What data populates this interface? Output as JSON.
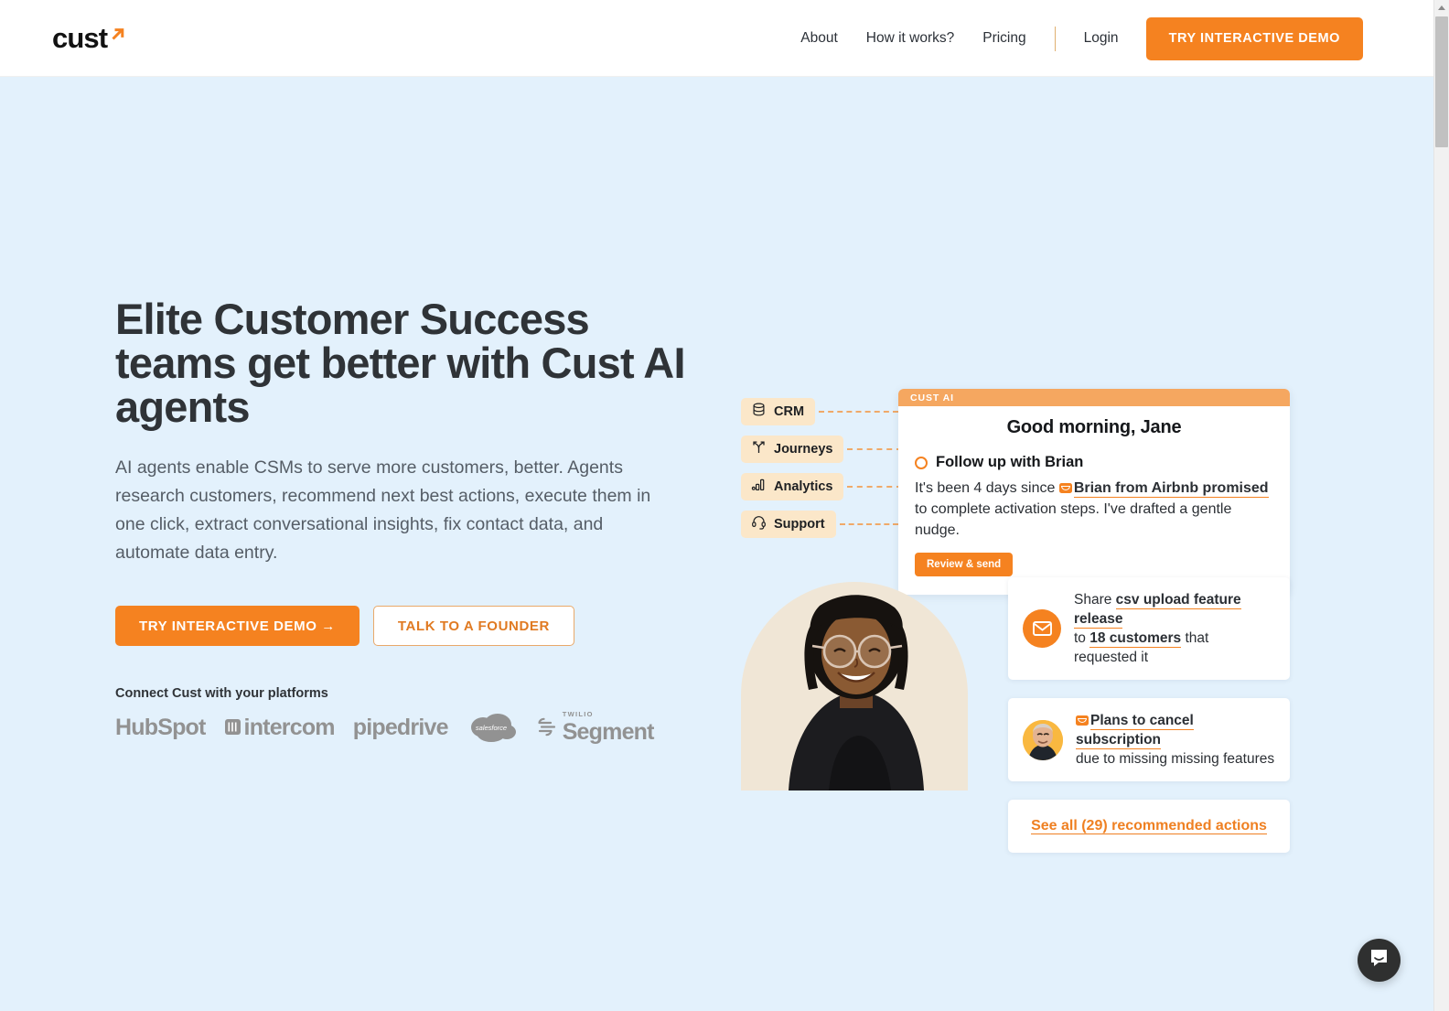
{
  "header": {
    "logo_text": "cust",
    "logo_arrow_icon": "arrow-up-right-icon",
    "nav_links": [
      {
        "label": "About"
      },
      {
        "label": "How it works?"
      },
      {
        "label": "Pricing"
      }
    ],
    "login_label": "Login",
    "cta_label": "TRY INTERACTIVE DEMO"
  },
  "hero": {
    "headline": "Elite Customer Success teams get better with Cust AI agents",
    "subhead": "AI agents enable CSMs to serve more customers, better. Agents research customers, recommend next best actions, execute them in one click, extract conversational insights, fix contact data, and automate data entry.",
    "primary_cta": "TRY INTERACTIVE DEMO →",
    "secondary_cta": "TALK TO A FOUNDER",
    "platforms_label": "Connect Cust with your platforms",
    "platforms": [
      {
        "name": "HubSpot",
        "icon": "hubspot-logo"
      },
      {
        "name": "intercom",
        "icon": "intercom-logo"
      },
      {
        "name": "pipedrive",
        "icon": "pipedrive-logo"
      },
      {
        "name": "salesforce",
        "icon": "salesforce-logo"
      },
      {
        "name": "Segment",
        "icon": "twilio-segment-logo",
        "eyebrow": "TWILIO"
      }
    ]
  },
  "graphic": {
    "chips": [
      {
        "label": "CRM",
        "icon": "database-icon"
      },
      {
        "label": "Journeys",
        "icon": "branching-arrow-icon"
      },
      {
        "label": "Analytics",
        "icon": "bar-chart-icon"
      },
      {
        "label": "Support",
        "icon": "headset-icon"
      }
    ],
    "cust_card": {
      "badge": "CUST AI",
      "greeting": "Good morning, Jane",
      "task_title": "Follow up with Brian",
      "body_pre": "It's been 4 days since ",
      "body_highlight": "Brian from Airbnb promised",
      "body_post": " to complete activation steps. I've drafted a gentle nudge.",
      "button_label": "Review & send"
    },
    "portrait_alt": "smiling-csm-portrait",
    "action_cards": [
      {
        "icon": "mail-circle-icon",
        "line1_pre": "Share ",
        "line1_highlight": "csv upload feature release",
        "line2_pre": "to ",
        "line2_highlight": "18 customers",
        "line2_post": " that requested it"
      },
      {
        "icon": "avatar-photo",
        "title": "Plans to cancel subscription",
        "subtitle": "due to missing missing features"
      }
    ],
    "see_all_label": "See all (29) recommended actions"
  },
  "launcher": {
    "icon": "intercom-chat-icon"
  },
  "colors": {
    "orange": "#f58220",
    "orange_light": "#f5a760",
    "hero_bg": "#e3f1fc",
    "chip_bg": "#fbe7c9",
    "text_dark": "#2f3337"
  }
}
